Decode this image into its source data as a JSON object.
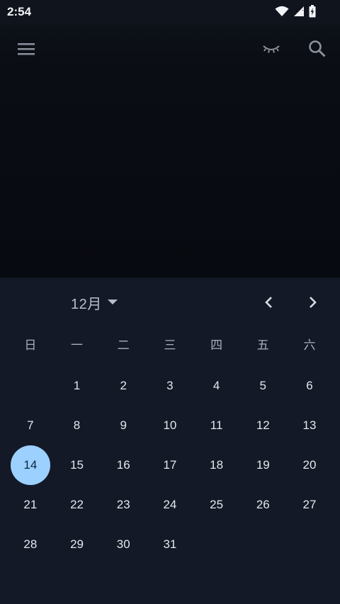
{
  "status": {
    "time": "2:54"
  },
  "appbar": {
    "menu_icon": "menu-icon",
    "hide_icon": "eye-closed-icon",
    "search_icon": "search-icon"
  },
  "calendar": {
    "month_label": "12月",
    "weekdays": [
      "日",
      "一",
      "二",
      "三",
      "四",
      "五",
      "六"
    ],
    "leading_blanks": 1,
    "days": [
      "1",
      "2",
      "3",
      "4",
      "5",
      "6",
      "7",
      "8",
      "9",
      "10",
      "11",
      "12",
      "13",
      "14",
      "15",
      "16",
      "17",
      "18",
      "19",
      "20",
      "21",
      "22",
      "23",
      "24",
      "25",
      "26",
      "27",
      "28",
      "29",
      "30",
      "31"
    ],
    "selected_day": "14",
    "accent_color": "#9cd0ff"
  }
}
